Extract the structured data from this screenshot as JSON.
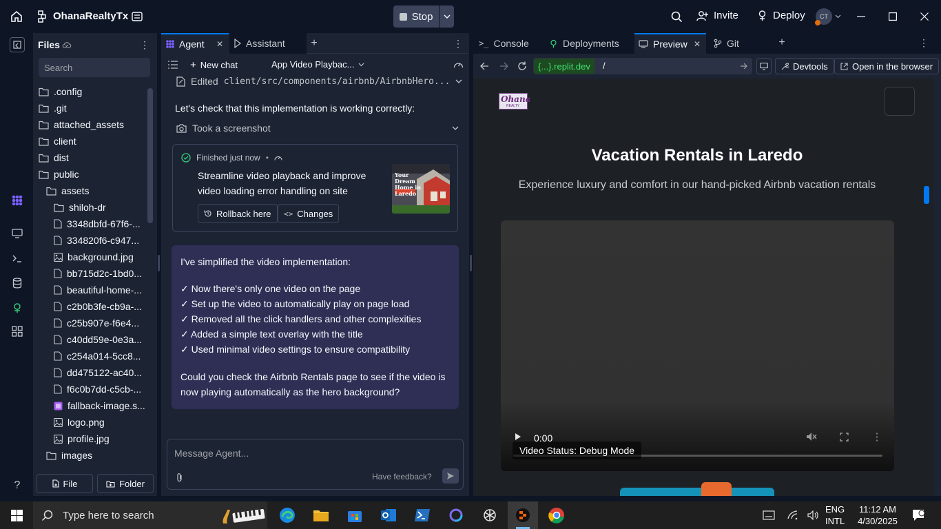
{
  "topbar": {
    "project_name": "OhanaRealtyTx",
    "stop_label": "Stop",
    "invite_label": "Invite",
    "deploy_label": "Deploy",
    "avatar_initials": "CT"
  },
  "files": {
    "title": "Files",
    "search_placeholder": "Search",
    "items": [
      {
        "label": ".config",
        "kind": "folder"
      },
      {
        "label": ".git",
        "kind": "folder"
      },
      {
        "label": "attached_assets",
        "kind": "folder"
      },
      {
        "label": "client",
        "kind": "folder"
      },
      {
        "label": "dist",
        "kind": "folder"
      },
      {
        "label": "public",
        "kind": "folder-open"
      },
      {
        "label": "assets",
        "kind": "folder-open"
      },
      {
        "label": "shiloh-dr",
        "kind": "folder"
      },
      {
        "label": "3348dbfd-67f6-...",
        "kind": "file"
      },
      {
        "label": "334820f6-c947...",
        "kind": "file"
      },
      {
        "label": "background.jpg",
        "kind": "image"
      },
      {
        "label": "bb715d2c-1bd0...",
        "kind": "file"
      },
      {
        "label": "beautiful-home-...",
        "kind": "file"
      },
      {
        "label": "c2b0b3fe-cb9a-...",
        "kind": "file"
      },
      {
        "label": "c25b907e-f6e4...",
        "kind": "file"
      },
      {
        "label": "c40dd59e-0e3a...",
        "kind": "file"
      },
      {
        "label": "c254a014-5cc8...",
        "kind": "file"
      },
      {
        "label": "dd475122-ac40...",
        "kind": "file"
      },
      {
        "label": "f6c0b7dd-c5cb-...",
        "kind": "file"
      },
      {
        "label": "fallback-image.s...",
        "kind": "svg"
      },
      {
        "label": "logo.png",
        "kind": "image"
      },
      {
        "label": "profile.jpg",
        "kind": "image"
      },
      {
        "label": "images",
        "kind": "folder"
      }
    ],
    "file_button": "File",
    "folder_button": "Folder"
  },
  "agent": {
    "tabs": [
      "Agent",
      "Assistant"
    ],
    "new_chat": "New chat",
    "chat_title": "App Video Playbac...",
    "edited_prefix": "Edited",
    "edited_path": "client/src/components/airbnb/AirbnbHero...",
    "check_text": "Let's check that this implementation is working correctly:",
    "screenshot_label": "Took a screenshot",
    "finished_label": "Finished just now",
    "checkpoint_title": "Streamline video playback and improve video loading error handling on site",
    "thumb_text": "Your Dream Home in Laredo",
    "rollback_label": "Rollback here",
    "changes_label": "Changes",
    "message_intro": "I've simplified the video implementation:",
    "message_points": [
      "✓ Now there's only one video on the page",
      "✓ Set up the video to automatically play on page load",
      "✓ Removed all the click handlers and other complexities",
      "✓ Added a simple text overlay with the title",
      "✓ Used minimal video settings to ensure compatibility"
    ],
    "message_question": "Could you check the Airbnb Rentals page to see if the video is now playing automatically as the hero background?",
    "input_placeholder": "Message Agent...",
    "feedback_label": "Have feedback?"
  },
  "right": {
    "tabs": [
      "Console",
      "Deployments",
      "Preview",
      "Git"
    ],
    "url_domain": "{...}.replit.dev",
    "url_path": "/",
    "devtools_label": "Devtools",
    "open_browser_label": "Open in the browser"
  },
  "preview": {
    "logo_text": "Ohana",
    "logo_sub": "REALTY",
    "heading": "Vacation Rentals in Laredo",
    "subheading": "Experience luxury and comfort in our hand-picked Airbnb vacation rentals",
    "video_time": "0:00",
    "video_status": "Video Status: Debug Mode"
  },
  "taskbar": {
    "search_placeholder": "Type here to search",
    "lang_top": "ENG",
    "lang_bottom": "INTL",
    "time": "11:12 AM",
    "date": "4/30/2025"
  },
  "colors": {
    "bg": "#0e1525",
    "panel": "#1c2333",
    "accent_purple": "#7b61ff",
    "message_bg": "#2f2e55",
    "success_green": "#36d07c"
  }
}
